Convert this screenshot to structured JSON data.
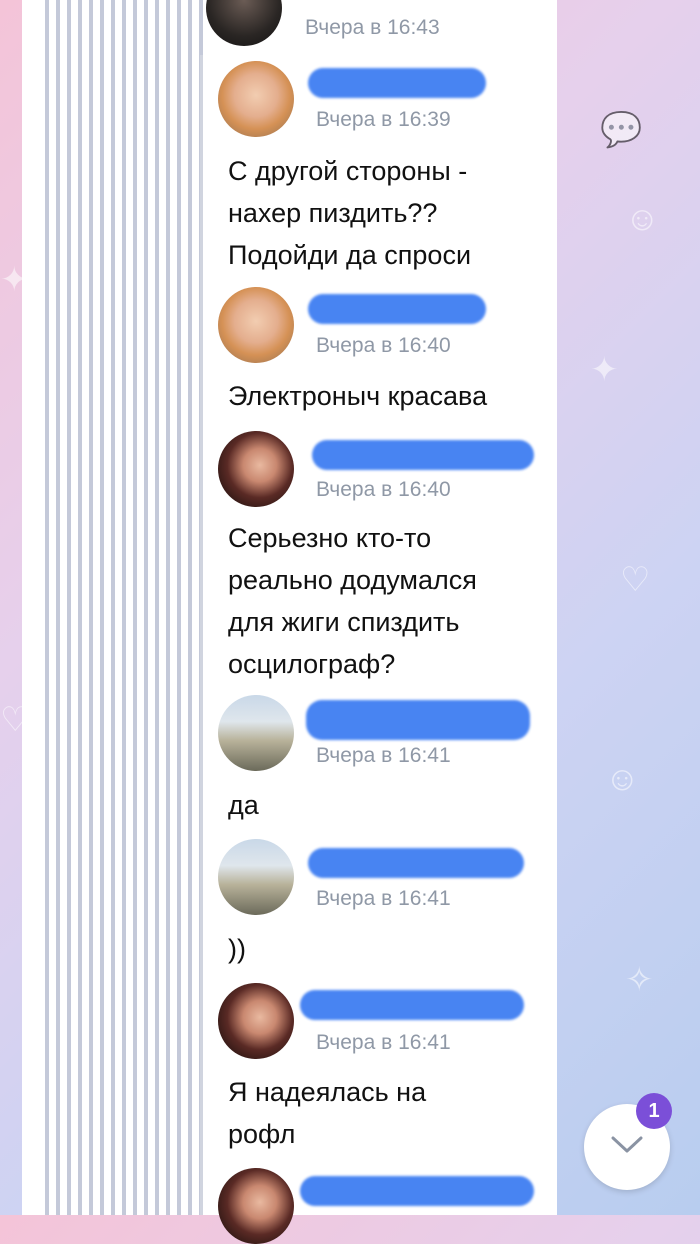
{
  "chat": {
    "messages": [
      {
        "time": "Вчера в 16:43",
        "text": ""
      },
      {
        "time": "Вчера в 16:39",
        "text": "С другой стороны -\nнахер пиздить??\nПодойди да спроси"
      },
      {
        "time": "Вчера в 16:40",
        "text": "Электроныч красава"
      },
      {
        "time": "Вчера в 16:40",
        "text": "Серьезно кто-то\nреально додумался\nдля жиги спиздить\nосцилограф?"
      },
      {
        "time": "Вчера в 16:41",
        "text": "да"
      },
      {
        "time": "Вчера в 16:41",
        "text": "))"
      },
      {
        "time": "Вчера в 16:41",
        "text": "Я надеялась на\nрофл"
      },
      {
        "time": "",
        "text": ""
      }
    ]
  },
  "scroll_button": {
    "badge_count": "1",
    "icon": "chevron-down-icon"
  },
  "colors": {
    "name_redaction": "#3f7ef2",
    "badge": "#7b4fd8",
    "timestamp": "#8f98a6"
  }
}
